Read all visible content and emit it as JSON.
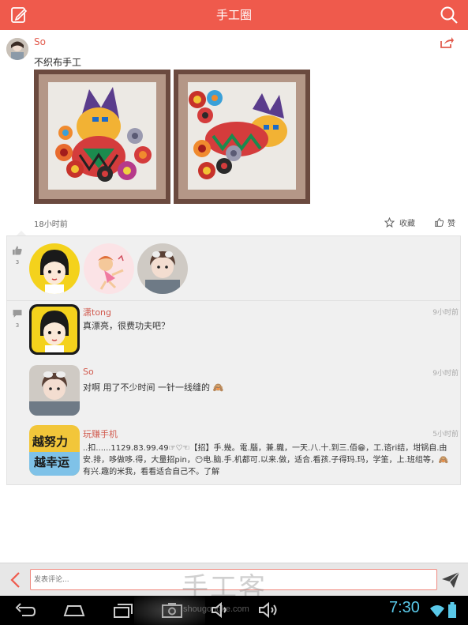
{
  "header": {
    "title": "手工圈",
    "edit_icon": "edit-icon",
    "search_icon": "search-icon"
  },
  "post": {
    "username": "So",
    "text": "不织布手工",
    "time": "18小时前",
    "favorite_label": "收藏",
    "like_label": "赞"
  },
  "likes": {
    "count": "3"
  },
  "comments_meta": {
    "count": "3"
  },
  "comments": [
    {
      "name": "潇tong",
      "time": "9小时前",
      "text": "真漂亮，很费功夫吧？"
    },
    {
      "name": "So",
      "time": "9小时前",
      "text": "对啊 用了不少时间 一针一线缝的 🙈"
    },
    {
      "name": "玩赚手机",
      "time": "5小时前",
      "text": "..扣......1129.83.99.49☞♡☜【招】手.幾。電.腦，兼.軄，一天.八.十.到三.佰😁，工.谘ri结，坩锅自.由安.排，哆做哆.得，大量招pin，😶电.脑.手.机都可.以来.做，适合.看孩.子得玛.玛，学筀，上.班组等，🙈有兴.趣的米我，看看适合自己不。了解"
    }
  ],
  "comment_bar": {
    "placeholder": "发表评论..."
  },
  "watermark": {
    "large": "手工客",
    "small": "shougongke.com"
  },
  "system_bar": {
    "time": "7:30"
  },
  "colors": {
    "accent": "#ef5a4c",
    "clock": "#59c8e8"
  }
}
